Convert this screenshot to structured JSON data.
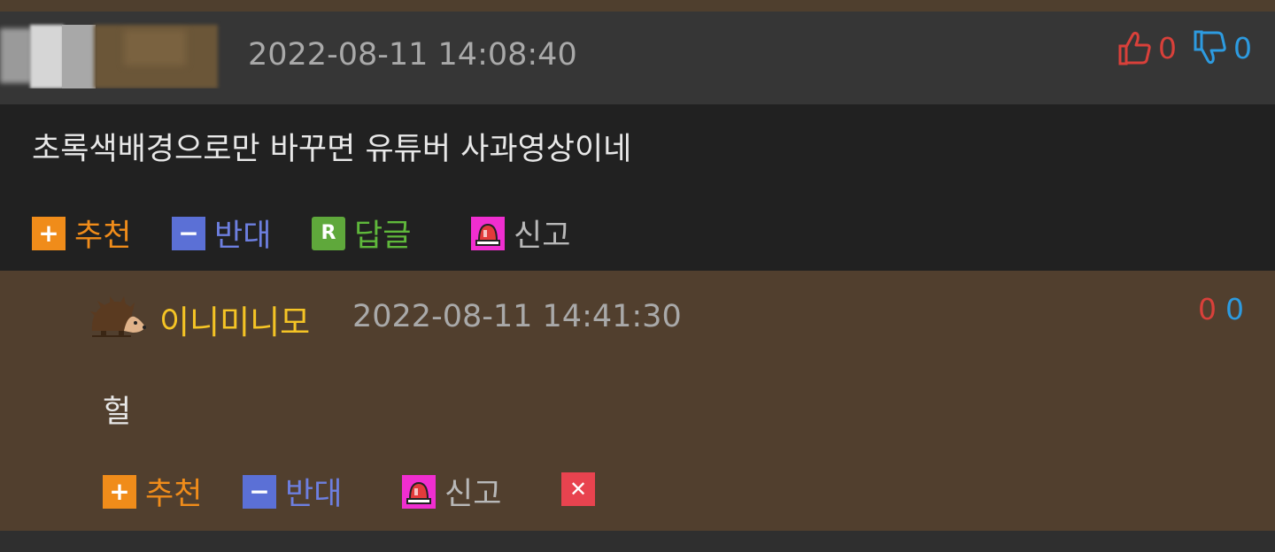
{
  "comments": [
    {
      "timestamp": "2022-08-11 14:08:40",
      "likes": "0",
      "dislikes": "0",
      "text": "초록색배경으로만 바꾸면 유튜버 사과영상이네",
      "actions": {
        "recommend_label": "추천",
        "oppose_label": "반대",
        "reply_label": "답글",
        "reply_icon_text": "R",
        "report_label": "신고"
      }
    },
    {
      "nickname": "이니미니모",
      "timestamp": "2022-08-11 14:41:30",
      "likes": "0",
      "dislikes": "0",
      "text": "헐",
      "actions": {
        "recommend_label": "추천",
        "oppose_label": "반대",
        "report_label": "신고"
      }
    }
  ],
  "icons": {
    "plus": "+",
    "minus": "−",
    "delete": "✕"
  },
  "colors": {
    "recommend": "#f08c1a",
    "oppose": "#6d7fe0",
    "reply": "#5fb83b",
    "report_icon": "#f02ed0",
    "delete": "#e8434f",
    "likes": "#d9403a",
    "dislikes": "#2d9be0",
    "nickname": "#f5c425"
  }
}
